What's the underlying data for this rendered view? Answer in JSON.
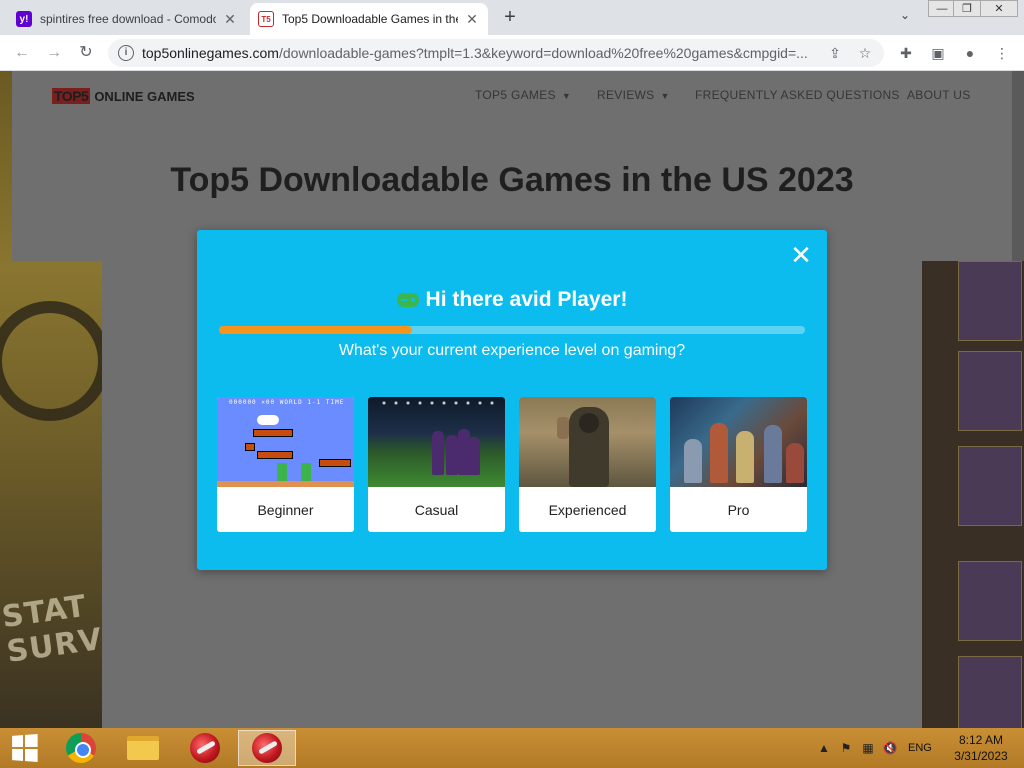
{
  "browser": {
    "tabs": [
      {
        "title": "spintires free download - Comodo",
        "favicon": "yahoo-icon",
        "favicon_text": "y!",
        "active": false
      },
      {
        "title": "Top5 Downloadable Games in the US 2023",
        "favicon": "top5-icon",
        "favicon_text": "T5",
        "active": true
      }
    ],
    "new_tab_glyph": "+",
    "close_glyph": "✕",
    "address": {
      "host": "top5onlinegames.com",
      "path": "/downloadable-games?tmplt=1.3&keyword=download%20free%20games&cmpgid=..."
    }
  },
  "site": {
    "logo_mark": "TOP5",
    "logo_text": "ONLINE GAMES",
    "nav": [
      {
        "label": "TOP5 GAMES",
        "dropdown": true
      },
      {
        "label": "REVIEWS",
        "dropdown": true
      },
      {
        "label": "FREQUENTLY ASKED QUESTIONS",
        "dropdown": false
      },
      {
        "label": "ABOUT US",
        "dropdown": false
      }
    ],
    "page_title": "Top5 Downloadable Games in the US 2023"
  },
  "modal": {
    "heading": "Hi there avid Player!",
    "progress": 0.33,
    "question": "What's your current experience level on gaming?",
    "options": [
      {
        "label": "Beginner",
        "image": "retro-platformer-image"
      },
      {
        "label": "Casual",
        "image": "soccer-game-image"
      },
      {
        "label": "Experienced",
        "image": "shooter-game-image"
      },
      {
        "label": "Pro",
        "image": "fantasy-battle-image"
      }
    ],
    "colors": {
      "background": "#0cbcef",
      "progress_fill": "#f7941d",
      "progress_track": "#5cd3f3"
    }
  },
  "taskbar": {
    "tray_language": "ENG",
    "time": "8:12 AM",
    "date": "3/31/2023"
  }
}
